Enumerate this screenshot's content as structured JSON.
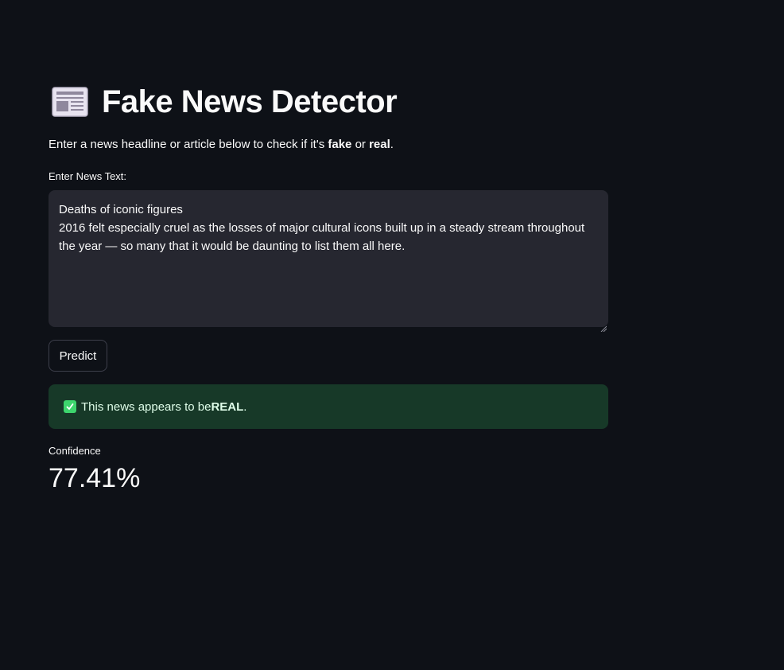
{
  "header": {
    "icon": "newspaper-icon",
    "title": "Fake News Detector"
  },
  "intro": {
    "prefix": "Enter a news headline or article below to check if it's ",
    "fake": "fake",
    "middle": " or ",
    "real": "real",
    "suffix": "."
  },
  "input": {
    "label": "Enter News Text:",
    "lines": [
      "Deaths of iconic figures",
      "2016 felt especially cruel as the losses of major cultural icons built up in a steady stream throughout",
      "the year — so many that it would be daunting to list them all here."
    ]
  },
  "actions": {
    "predict_label": "Predict"
  },
  "result": {
    "icon": "check-icon",
    "prefix": "This news appears to be ",
    "verdict": "REAL",
    "suffix": "."
  },
  "metric": {
    "label": "Confidence",
    "value": "77.41%"
  },
  "colors": {
    "background": "#0e1117",
    "input_bg": "#262730",
    "success_bg": "#173928",
    "success_icon": "#3dd56d"
  }
}
